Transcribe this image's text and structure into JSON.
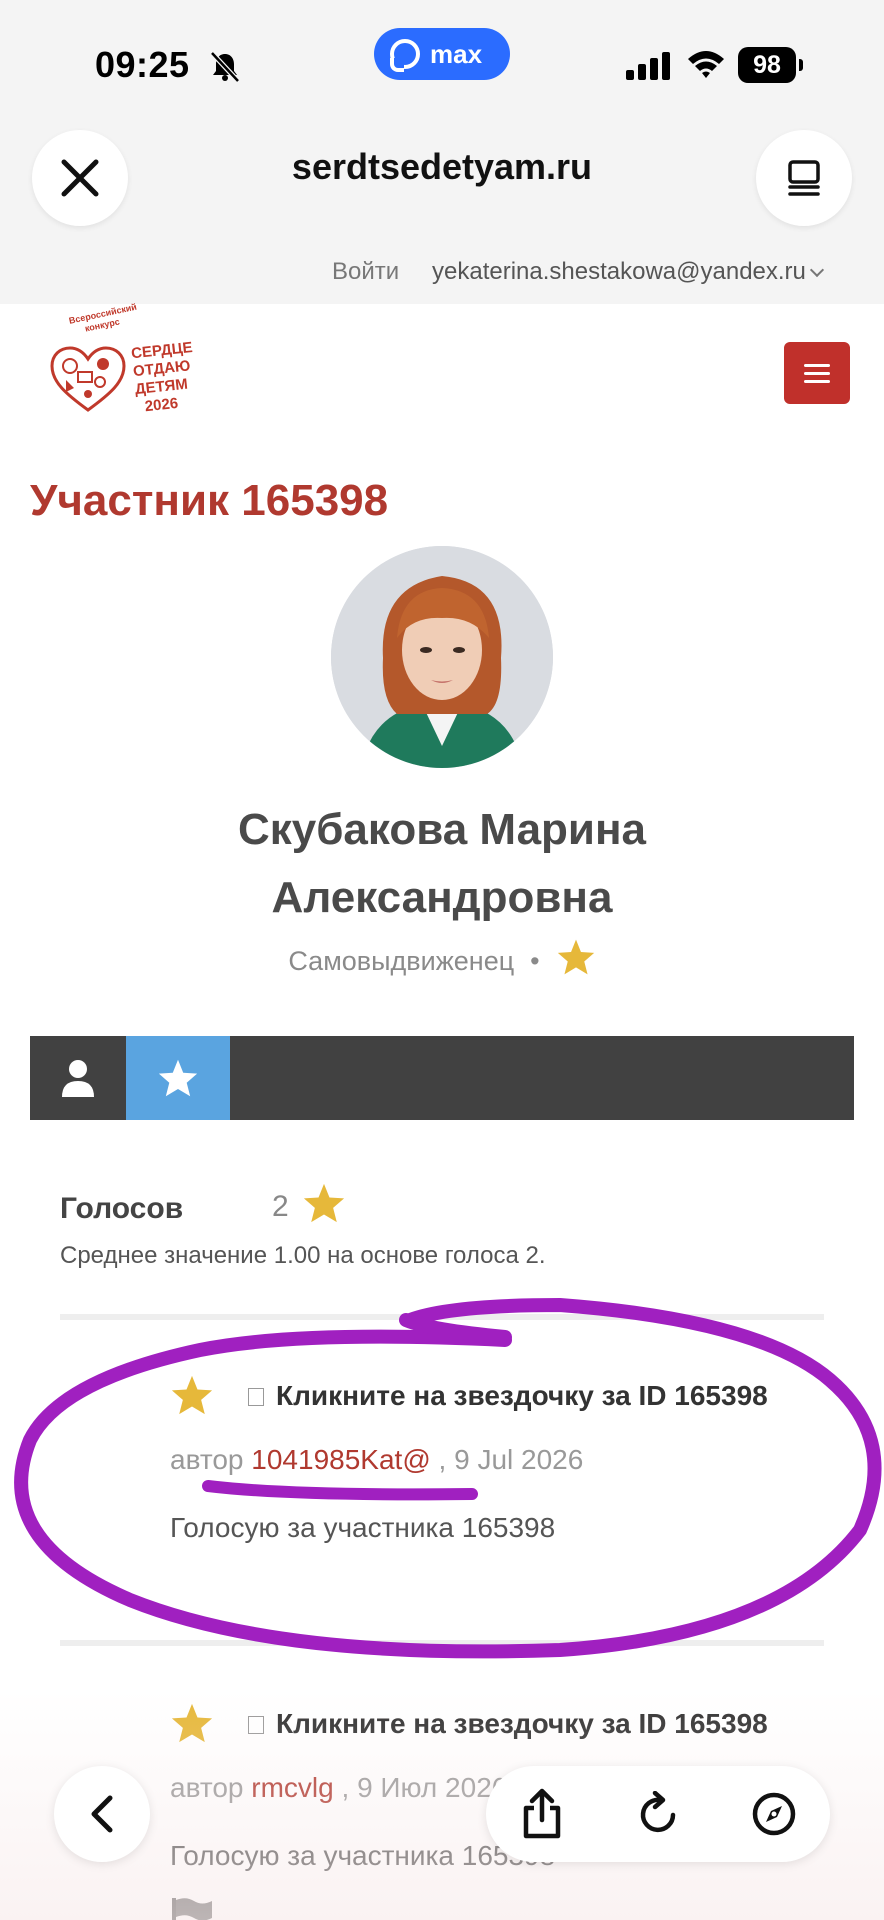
{
  "status_bar": {
    "time": "09:25",
    "app_pill_label": "max",
    "battery": "98"
  },
  "browser": {
    "url": "serdtsedetyam.ru",
    "login_label": "Войти",
    "account_email": "yekaterina.shestakowa@yandex.ru"
  },
  "site": {
    "logo_small_line1": "Всероссийский",
    "logo_small_line2": "конкурс",
    "logo_line1": "СЕРДЦЕ",
    "logo_line2": "ОТДАЮ",
    "logo_line3": "ДЕТЯМ",
    "logo_year": "2026",
    "accent_color": "#b0392f"
  },
  "participant": {
    "title": "Участник 165398",
    "name_line1": "Скубакова Марина",
    "name_line2": "Александровна",
    "nomination": "Самовыдвиженец",
    "separator": "•"
  },
  "tabs": [
    {
      "icon": "user-icon",
      "active": false
    },
    {
      "icon": "star-icon",
      "active": true
    }
  ],
  "votes": {
    "label": "Голосов",
    "count": "2",
    "average_text": "Среднее значение 1.00 на основе голоса 2."
  },
  "entries": [
    {
      "title": "Кликните на звездочку за ID 165398",
      "author_prefix": "автор",
      "author": "1041985Kat@",
      "date": ", 9 Jul 2026",
      "text": "Голосую за участника 165398"
    },
    {
      "title": "Кликните на звездочку за ID 165398",
      "author_prefix": "автор",
      "author": "rmcvlg",
      "date": ", 9 Июл 2026",
      "text": "Голосую за участника 165398"
    }
  ],
  "annotation_color": "#a020c0"
}
